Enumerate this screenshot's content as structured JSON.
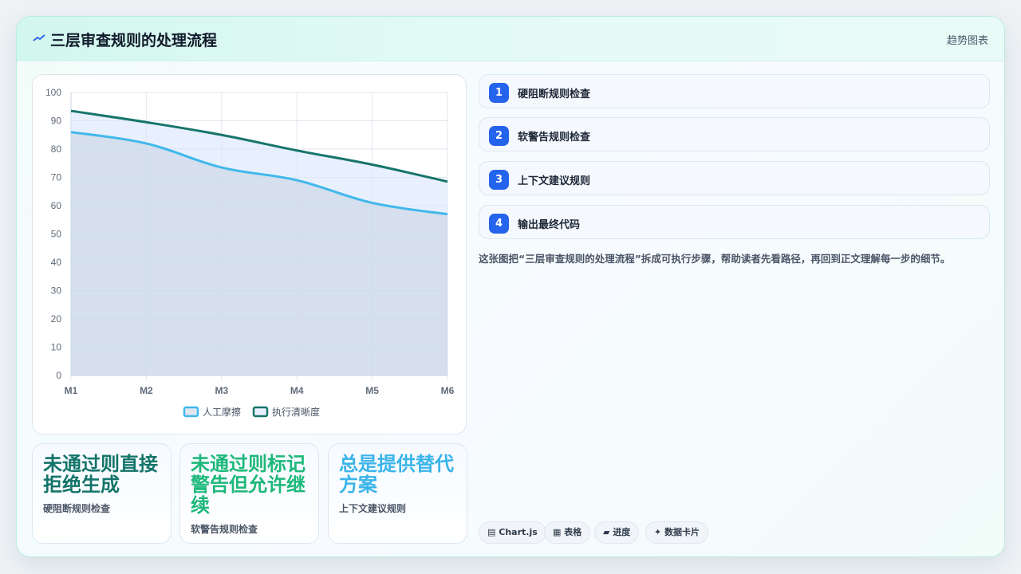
{
  "header": {
    "title": "三层审查规则的处理流程",
    "tag": "趋势图表"
  },
  "steps": [
    {
      "num": "1",
      "label": "硬阻断规则检查"
    },
    {
      "num": "2",
      "label": "软警告规则检查"
    },
    {
      "num": "3",
      "label": "上下文建议规则"
    },
    {
      "num": "4",
      "label": "输出最终代码"
    }
  ],
  "description": "这张图把“三层审查规则的处理流程”拆成可执行步骤，帮助读者先看路径，再回到正文理解每一步的细节。",
  "stats": [
    {
      "value": "未通过则直接拒绝生成",
      "sub": "硬阻断规则检查",
      "color": "#14746a"
    },
    {
      "value": "未通过则标记警告但允许继续",
      "sub": "软警告规则检查",
      "color": "#1db87a"
    },
    {
      "value": "总是提供替代方案",
      "sub": "上下文建议规则",
      "color": "#3ab4ea"
    }
  ],
  "chips": [
    {
      "icon": "▤",
      "label": "Chart.js"
    },
    {
      "icon": "▦",
      "label": "表格"
    },
    {
      "icon": "▰",
      "label": "进度"
    },
    {
      "icon": "✦",
      "label": "数据卡片"
    }
  ],
  "chart_data": {
    "type": "area",
    "categories": [
      "M1",
      "M2",
      "M3",
      "M4",
      "M5",
      "M6"
    ],
    "series": [
      {
        "name": "人工摩擦",
        "values": [
          86,
          82,
          73.5,
          69,
          61,
          57
        ],
        "color": "#41b8ea",
        "fill": "rgba(200,212,228,0.6)"
      },
      {
        "name": "执行清晰度",
        "values": [
          93.5,
          89.5,
          85,
          79.5,
          74.5,
          68.5
        ],
        "color": "#17756c",
        "fill": "rgba(218,230,251,0.6)"
      }
    ],
    "ylim": [
      0,
      100
    ],
    "yticks": [
      0,
      10,
      20,
      30,
      40,
      50,
      60,
      70,
      80,
      90,
      100
    ],
    "grid": true,
    "legend": "bottom"
  }
}
